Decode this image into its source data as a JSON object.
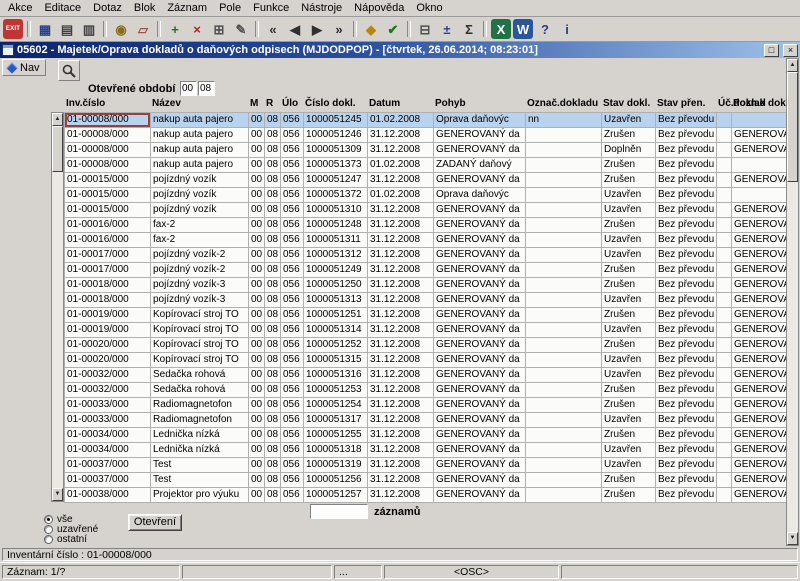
{
  "menu": {
    "items": [
      "Akce",
      "Editace",
      "Dotaz",
      "Blok",
      "Záznam",
      "Pole",
      "Funkce",
      "Nástroje",
      "Nápověda",
      "Okno"
    ]
  },
  "toolbar": {
    "icons": [
      {
        "name": "exit-button",
        "glyph": "EXIT",
        "fg": "#ffffff",
        "bg": "#c03434",
        "small": true,
        "ia": true
      },
      {
        "name": "toolbar-separator",
        "sep": true,
        "ia": false
      },
      {
        "name": "save-icon",
        "glyph": "▦",
        "fg": "#27408b",
        "ia": true
      },
      {
        "name": "print-icon",
        "glyph": "▤",
        "fg": "#404040",
        "ia": true
      },
      {
        "name": "print-preview-icon",
        "glyph": "▥",
        "fg": "#404040",
        "ia": true
      },
      {
        "name": "toolbar-separator",
        "sep": true,
        "ia": false
      },
      {
        "name": "search-flashlight-icon",
        "glyph": "◉",
        "fg": "#8a6d1a",
        "ia": true
      },
      {
        "name": "clear-eraser-icon",
        "glyph": "▱",
        "fg": "#a05050",
        "ia": true
      },
      {
        "name": "toolbar-separator",
        "sep": true,
        "ia": false
      },
      {
        "name": "insert-record-icon",
        "glyph": "+",
        "fg": "#1a7a1a",
        "ia": true
      },
      {
        "name": "delete-record-icon",
        "glyph": "×",
        "fg": "#b22222",
        "ia": true
      },
      {
        "name": "duplicate-record-icon",
        "glyph": "⊞",
        "fg": "#505050",
        "ia": true
      },
      {
        "name": "edit-field-icon",
        "glyph": "✎",
        "fg": "#505050",
        "ia": true
      },
      {
        "name": "toolbar-separator",
        "sep": true,
        "ia": false
      },
      {
        "name": "first-record-icon",
        "glyph": "«",
        "fg": "#303030",
        "ia": true
      },
      {
        "name": "previous-record-icon",
        "glyph": "◀",
        "fg": "#303030",
        "ia": true
      },
      {
        "name": "next-record-icon",
        "glyph": "▶",
        "fg": "#303030",
        "ia": true
      },
      {
        "name": "last-record-icon",
        "glyph": "»",
        "fg": "#303030",
        "ia": true
      },
      {
        "name": "toolbar-separator",
        "sep": true,
        "ia": false
      },
      {
        "name": "lock-record-icon",
        "glyph": "◆",
        "fg": "#b8860b",
        "ia": true
      },
      {
        "name": "commit-icon",
        "glyph": "✔",
        "fg": "#1a7a1a",
        "ia": true
      },
      {
        "name": "toolbar-separator",
        "sep": true,
        "ia": false
      },
      {
        "name": "calendar-icon",
        "glyph": "⊟",
        "fg": "#505050",
        "ia": true
      },
      {
        "name": "calculator-icon",
        "glyph": "±",
        "fg": "#27408b",
        "ia": true
      },
      {
        "name": "sum-icon",
        "glyph": "Σ",
        "fg": "#303030",
        "ia": true
      },
      {
        "name": "toolbar-separator",
        "sep": true,
        "ia": false
      },
      {
        "name": "excel-export-icon",
        "glyph": "X",
        "fg": "#ffffff",
        "bg": "#217346",
        "ia": true
      },
      {
        "name": "word-export-icon",
        "glyph": "W",
        "fg": "#ffffff",
        "bg": "#2b579a",
        "ia": true
      },
      {
        "name": "help-icon",
        "glyph": "?",
        "fg": "#27408b",
        "ia": true
      },
      {
        "name": "info-icon",
        "glyph": "i",
        "fg": "#27408b",
        "ia": true
      }
    ]
  },
  "window": {
    "title": "05602 - Majetek/Oprava dokladů o daňových odpisech (MJDODPOP) - [čtvrtek, 26.06.2014; 08:23:01]",
    "restore_glyph": "□",
    "close_glyph": "×"
  },
  "ui": {
    "scroll_up_glyph": "▲",
    "scroll_down_glyph": "▼"
  },
  "nav": {
    "label": "Nav"
  },
  "period": {
    "label": "Otevřené období",
    "values": [
      "00",
      "08"
    ]
  },
  "table": {
    "columns": [
      "Inv.číslo",
      "Název",
      "M",
      "R",
      "Úlo",
      "Číslo dokl.",
      "Datum",
      "Pohyb",
      "Označ.dokladu",
      "Stav dokl.",
      "Stav přen.",
      "Úč.doklad",
      "Pozn.k dokl."
    ],
    "rows": [
      {
        "sel": true,
        "c": [
          "01-00008/000",
          "nakup auta pajero",
          "00",
          "08",
          "056",
          "1000051245",
          "01.02.2008",
          "Oprava daňovýc",
          "nn",
          "Uzavřen",
          "Bez převodu -",
          "",
          ""
        ]
      },
      {
        "c": [
          "01-00008/000",
          "nakup auta pajero",
          "00",
          "08",
          "056",
          "1000051246",
          "31.12.2008",
          "GENEROVANÝ da",
          "",
          "Zrušen",
          "Bez převodu -",
          "",
          "GENEROVANÝ"
        ]
      },
      {
        "c": [
          "01-00008/000",
          "nakup auta pajero",
          "00",
          "08",
          "056",
          "1000051309",
          "31.12.2008",
          "GENEROVANÝ da",
          "",
          "Doplněn",
          "Bez převodu -",
          "",
          "GENEROVANÝ"
        ]
      },
      {
        "c": [
          "01-00008/000",
          "nakup auta pajero",
          "00",
          "08",
          "056",
          "1000051373",
          "01.02.2008",
          "ZADANÝ daňový",
          "",
          "Zrušen",
          "Bez převodu -",
          "",
          ""
        ]
      },
      {
        "c": [
          "01-00015/000",
          "pojízdný vozík",
          "00",
          "08",
          "056",
          "1000051247",
          "31.12.2008",
          "GENEROVANÝ da",
          "",
          "Zrušen",
          "Bez převodu -",
          "",
          "GENEROVANÝ"
        ]
      },
      {
        "c": [
          "01-00015/000",
          "pojízdný vozík",
          "00",
          "08",
          "056",
          "1000051372",
          "01.02.2008",
          "Oprava daňovýc",
          "",
          "Uzavřen",
          "Bez převodu -",
          "",
          ""
        ]
      },
      {
        "c": [
          "01-00015/000",
          "pojízdný vozík",
          "00",
          "08",
          "056",
          "1000051310",
          "31.12.2008",
          "GENEROVANÝ da",
          "",
          "Uzavřen",
          "Bez převodu -",
          "",
          "GENEROVANÝ"
        ]
      },
      {
        "c": [
          "01-00016/000",
          "fax-2",
          "00",
          "08",
          "056",
          "1000051248",
          "31.12.2008",
          "GENEROVANÝ da",
          "",
          "Zrušen",
          "Bez převodu -",
          "",
          "GENEROVANÝ"
        ]
      },
      {
        "c": [
          "01-00016/000",
          "fax-2",
          "00",
          "08",
          "056",
          "1000051311",
          "31.12.2008",
          "GENEROVANÝ da",
          "",
          "Uzavřen",
          "Bez převodu -",
          "",
          "GENEROVANÝ"
        ]
      },
      {
        "c": [
          "01-00017/000",
          "pojízdný vozík-2",
          "00",
          "08",
          "056",
          "1000051312",
          "31.12.2008",
          "GENEROVANÝ da",
          "",
          "Uzavřen",
          "Bez převodu -",
          "",
          "GENEROVANÝ"
        ]
      },
      {
        "c": [
          "01-00017/000",
          "pojízdný vozík-2",
          "00",
          "08",
          "056",
          "1000051249",
          "31.12.2008",
          "GENEROVANÝ da",
          "",
          "Zrušen",
          "Bez převodu -",
          "",
          "GENEROVANÝ"
        ]
      },
      {
        "c": [
          "01-00018/000",
          "pojízdný vozík-3",
          "00",
          "08",
          "056",
          "1000051250",
          "31.12.2008",
          "GENEROVANÝ da",
          "",
          "Zrušen",
          "Bez převodu -",
          "",
          "GENEROVANÝ"
        ]
      },
      {
        "c": [
          "01-00018/000",
          "pojízdný vozík-3",
          "00",
          "08",
          "056",
          "1000051313",
          "31.12.2008",
          "GENEROVANÝ da",
          "",
          "Uzavřen",
          "Bez převodu -",
          "",
          "GENEROVANÝ"
        ]
      },
      {
        "c": [
          "01-00019/000",
          "Kopírovací stroj TO",
          "00",
          "08",
          "056",
          "1000051251",
          "31.12.2008",
          "GENEROVANÝ da",
          "",
          "Zrušen",
          "Bez převodu -",
          "",
          "GENEROVANÝ"
        ]
      },
      {
        "c": [
          "01-00019/000",
          "Kopírovací stroj TO",
          "00",
          "08",
          "056",
          "1000051314",
          "31.12.2008",
          "GENEROVANÝ da",
          "",
          "Uzavřen",
          "Bez převodu -",
          "",
          "GENEROVANÝ"
        ]
      },
      {
        "c": [
          "01-00020/000",
          "Kopírovací stroj TO",
          "00",
          "08",
          "056",
          "1000051252",
          "31.12.2008",
          "GENEROVANÝ da",
          "",
          "Zrušen",
          "Bez převodu -",
          "",
          "GENEROVANÝ"
        ]
      },
      {
        "c": [
          "01-00020/000",
          "Kopírovací stroj TO",
          "00",
          "08",
          "056",
          "1000051315",
          "31.12.2008",
          "GENEROVANÝ da",
          "",
          "Uzavřen",
          "Bez převodu -",
          "",
          "GENEROVANÝ"
        ]
      },
      {
        "c": [
          "01-00032/000",
          "Sedačka rohová",
          "00",
          "08",
          "056",
          "1000051316",
          "31.12.2008",
          "GENEROVANÝ da",
          "",
          "Uzavřen",
          "Bez převodu -",
          "",
          "GENEROVANÝ"
        ]
      },
      {
        "c": [
          "01-00032/000",
          "Sedačka rohová",
          "00",
          "08",
          "056",
          "1000051253",
          "31.12.2008",
          "GENEROVANÝ da",
          "",
          "Zrušen",
          "Bez převodu -",
          "",
          "GENEROVANÝ"
        ]
      },
      {
        "c": [
          "01-00033/000",
          "Radiomagnetofon",
          "00",
          "08",
          "056",
          "1000051254",
          "31.12.2008",
          "GENEROVANÝ da",
          "",
          "Zrušen",
          "Bez převodu -",
          "",
          "GENEROVANÝ"
        ]
      },
      {
        "c": [
          "01-00033/000",
          "Radiomagnetofon",
          "00",
          "08",
          "056",
          "1000051317",
          "31.12.2008",
          "GENEROVANÝ da",
          "",
          "Uzavřen",
          "Bez převodu -",
          "",
          "GENEROVANÝ"
        ]
      },
      {
        "c": [
          "01-00034/000",
          "Lednička nízká",
          "00",
          "08",
          "056",
          "1000051255",
          "31.12.2008",
          "GENEROVANÝ da",
          "",
          "Zrušen",
          "Bez převodu -",
          "",
          "GENEROVANÝ"
        ]
      },
      {
        "c": [
          "01-00034/000",
          "Lednička nízká",
          "00",
          "08",
          "056",
          "1000051318",
          "31.12.2008",
          "GENEROVANÝ da",
          "",
          "Uzavřen",
          "Bez převodu -",
          "",
          "GENEROVANÝ"
        ]
      },
      {
        "c": [
          "01-00037/000",
          "Test",
          "00",
          "08",
          "056",
          "1000051319",
          "31.12.2008",
          "GENEROVANÝ da",
          "",
          "Uzavřen",
          "Bez převodu -",
          "",
          "GENEROVANÝ"
        ]
      },
      {
        "c": [
          "01-00037/000",
          "Test",
          "00",
          "08",
          "056",
          "1000051256",
          "31.12.2008",
          "GENEROVANÝ da",
          "",
          "Zrušen",
          "Bez převodu -",
          "",
          "GENEROVANÝ"
        ]
      },
      {
        "c": [
          "01-00038/000",
          "Projektor pro výuku",
          "00",
          "08",
          "056",
          "1000051257",
          "31.12.2008",
          "GENEROVANÝ da",
          "",
          "Zrušen",
          "Bez převodu -",
          "",
          "GENEROVANÝ"
        ]
      }
    ]
  },
  "records": {
    "value": "",
    "label": "záznamů"
  },
  "filter": {
    "options": [
      {
        "label": "vše",
        "checked": true
      },
      {
        "label": "uzavřené",
        "checked": false
      },
      {
        "label": "ostatní",
        "checked": false
      }
    ],
    "button_label": "Otevření"
  },
  "status": {
    "line1": "Inventární číslo : 01-00008/000",
    "record": "Záznam: 1/?",
    "dots": "...",
    "osc": "<OSC>"
  }
}
